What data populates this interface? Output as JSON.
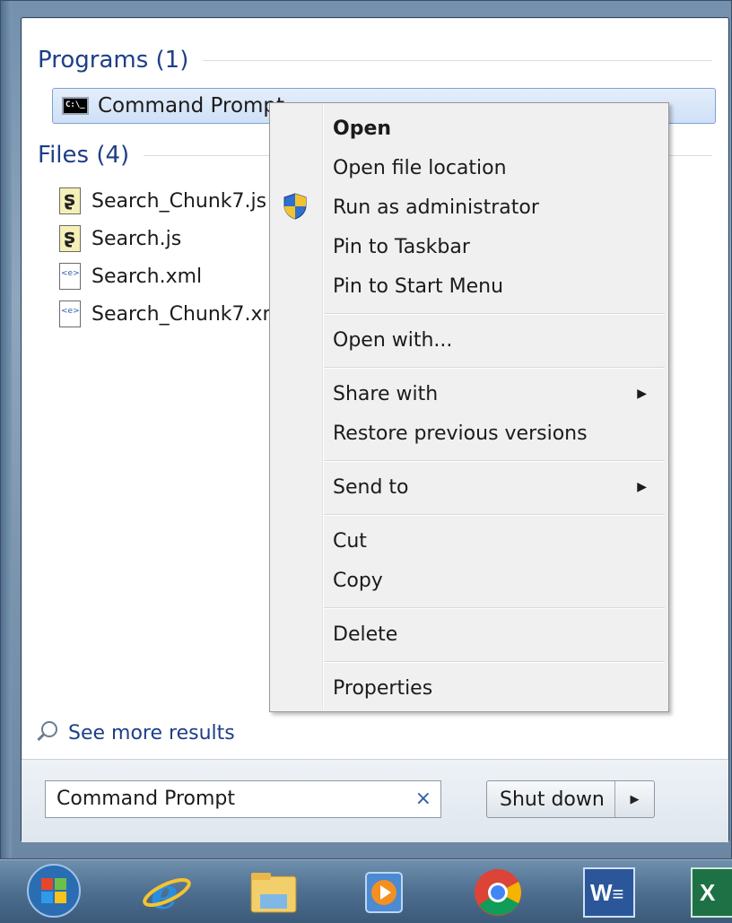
{
  "start_menu": {
    "programs_header": "Programs (1)",
    "program_items": [
      {
        "label": "Command Prompt",
        "icon": "cmd-icon"
      }
    ],
    "files_header": "Files (4)",
    "file_items": [
      {
        "label": "Search_Chunk7.js",
        "icon": "js-file-icon"
      },
      {
        "label": "Search.js",
        "icon": "js-file-icon"
      },
      {
        "label": "Search.xml",
        "icon": "xml-file-icon"
      },
      {
        "label": "Search_Chunk7.xm",
        "icon": "xml-file-icon"
      }
    ],
    "see_more_label": "See more results",
    "search": {
      "value": "Command Prompt",
      "clear_glyph": "×"
    },
    "shutdown_label": "Shut down",
    "shutdown_arrow": "▶"
  },
  "context_menu": {
    "groups": [
      [
        {
          "label": "Open",
          "bold": true
        },
        {
          "label": "Open file location"
        },
        {
          "label": "Run as administrator",
          "icon": "uac-shield-icon"
        },
        {
          "label": "Pin to Taskbar"
        },
        {
          "label": "Pin to Start Menu"
        }
      ],
      [
        {
          "label": "Open with..."
        }
      ],
      [
        {
          "label": "Share with",
          "submenu": true
        },
        {
          "label": "Restore previous versions"
        }
      ],
      [
        {
          "label": "Send to",
          "submenu": true
        }
      ],
      [
        {
          "label": "Cut"
        },
        {
          "label": "Copy"
        }
      ],
      [
        {
          "label": "Delete"
        }
      ],
      [
        {
          "label": "Properties"
        }
      ]
    ],
    "labels": {
      "open": "Open",
      "open_file_location": "Open file location",
      "run_as_admin": "Run as administrator",
      "pin_taskbar": "Pin to Taskbar",
      "pin_start": "Pin to Start Menu",
      "open_with": "Open with...",
      "share_with": "Share with",
      "restore_versions": "Restore previous versions",
      "send_to": "Send to",
      "cut": "Cut",
      "copy": "Copy",
      "delete": "Delete",
      "properties": "Properties",
      "submenu_arrow": "▶"
    }
  },
  "taskbar": {
    "items": [
      {
        "name": "start-orb-icon"
      },
      {
        "name": "internet-explorer-icon"
      },
      {
        "name": "file-explorer-icon"
      },
      {
        "name": "media-player-icon"
      },
      {
        "name": "chrome-icon"
      },
      {
        "name": "word-icon",
        "text": "W"
      },
      {
        "name": "excel-icon",
        "text": "X"
      }
    ]
  },
  "colors": {
    "accent": "#1e3f87",
    "selection": "#cfe0f7",
    "menu_bg": "#f0f0f0"
  }
}
